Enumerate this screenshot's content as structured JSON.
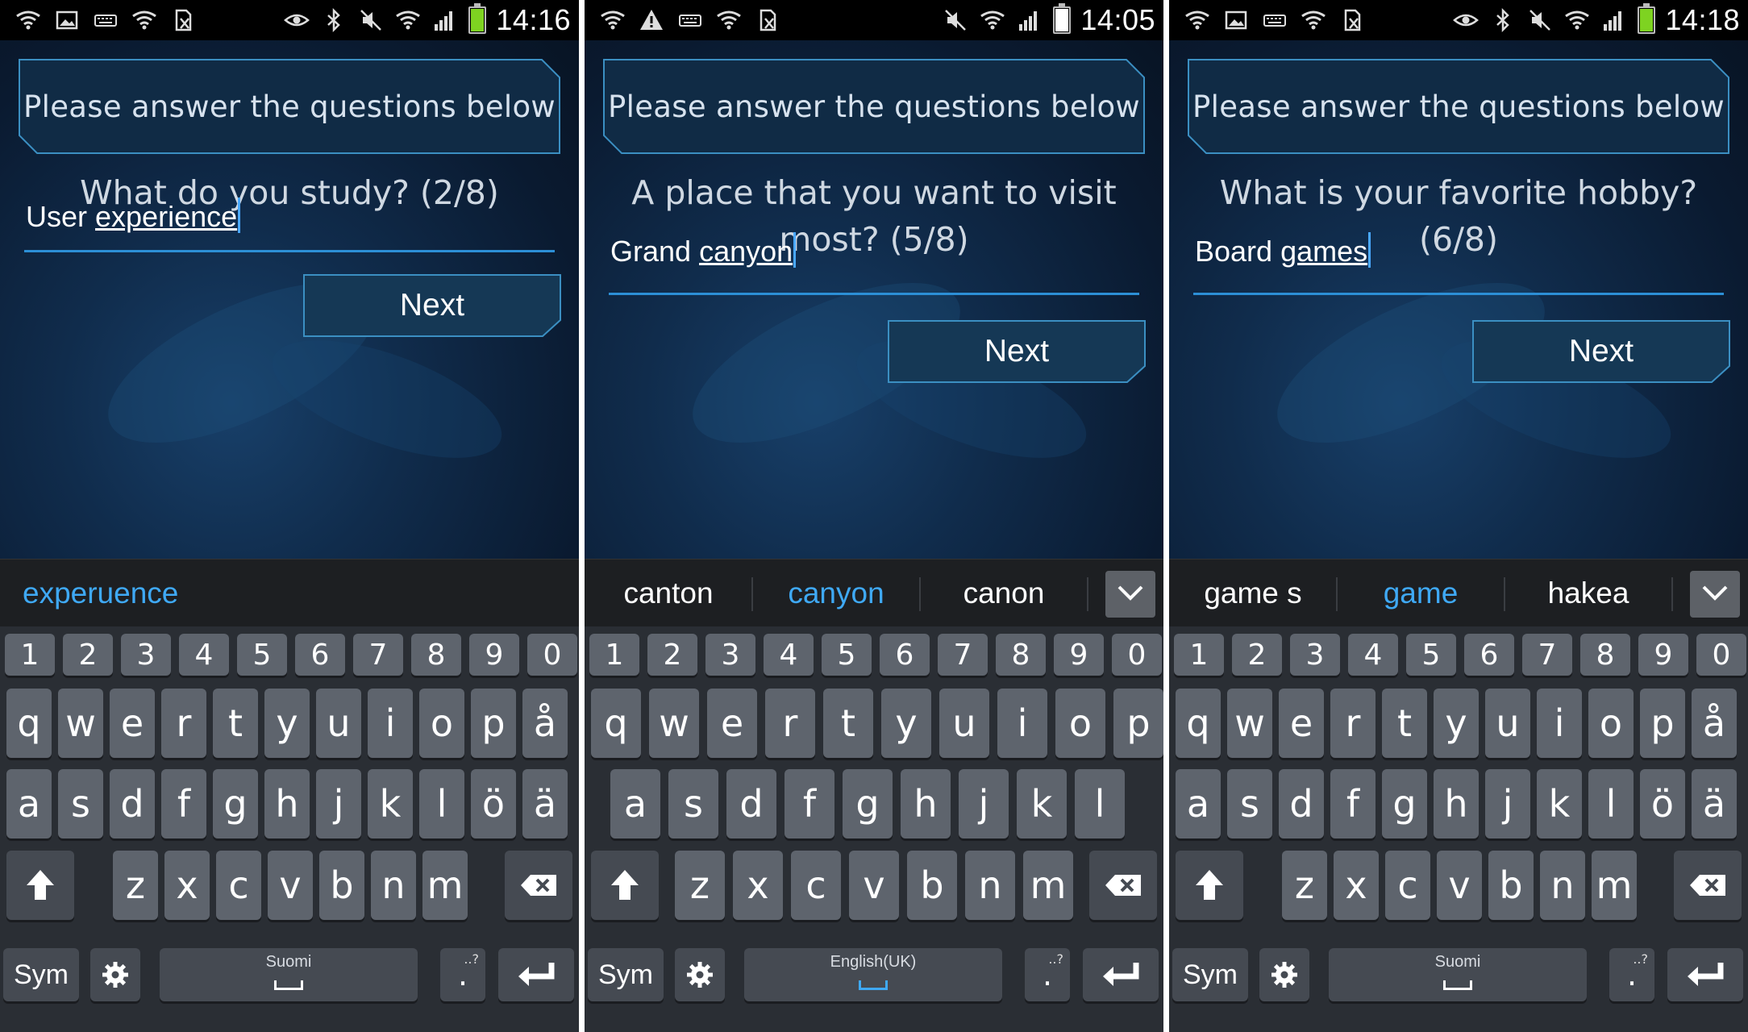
{
  "banner_text": "Please answer the questions below",
  "next_label": "Next",
  "sym_label": "Sym",
  "number_row": [
    "1",
    "2",
    "3",
    "4",
    "5",
    "6",
    "7",
    "8",
    "9",
    "0"
  ],
  "row_q_fi": [
    "q",
    "w",
    "e",
    "r",
    "t",
    "y",
    "u",
    "i",
    "o",
    "p",
    "å"
  ],
  "row_a_fi": [
    "a",
    "s",
    "d",
    "f",
    "g",
    "h",
    "j",
    "k",
    "l",
    "ö",
    "ä"
  ],
  "row_q_en": [
    "q",
    "w",
    "e",
    "r",
    "t",
    "y",
    "u",
    "i",
    "o",
    "p"
  ],
  "row_a_en": [
    "a",
    "s",
    "d",
    "f",
    "g",
    "h",
    "j",
    "k",
    "l"
  ],
  "row_z": [
    "z",
    "x",
    "c",
    "v",
    "b",
    "n",
    "m"
  ],
  "colors": {
    "accent": "#3fa9f5",
    "battery_green": "#7ed321",
    "battery_white": "#ffffff",
    "banner_stroke": "#3b8fc2"
  },
  "phones": [
    {
      "time": "14:16",
      "status_left_icons": [
        "wifi-icon",
        "image-icon",
        "keyboard-icon",
        "wifi-icon",
        "no-sim-icon"
      ],
      "status_right_icons": [
        "eye-icon",
        "bluetooth-icon",
        "mute-icon",
        "wifi-icon",
        "signal-icon",
        "battery-icon"
      ],
      "battery_color": "#7ed321",
      "question": "What do you study? (2/8)",
      "answer_plain": "User ",
      "answer_underlined": "experience",
      "suggestions": [
        "experuence"
      ],
      "highlighted": 0,
      "space_label": "Suomi",
      "layout": "fi"
    },
    {
      "time": "14:05",
      "status_left_icons": [
        "wifi-icon",
        "warning-icon",
        "keyboard-icon",
        "wifi-icon",
        "no-sim-icon"
      ],
      "status_right_icons": [
        "mute-icon",
        "wifi-icon",
        "signal-icon",
        "battery-icon"
      ],
      "battery_color": "#ffffff",
      "question": "A place that you want to visit most? (5/8)",
      "answer_plain": "Grand ",
      "answer_underlined": "canyon",
      "suggestions": [
        "canton",
        "canyon",
        "canon"
      ],
      "highlighted": 1,
      "space_label": "English(UK)",
      "layout": "en"
    },
    {
      "time": "14:18",
      "status_left_icons": [
        "wifi-icon",
        "image-icon",
        "keyboard-icon",
        "wifi-icon",
        "no-sim-icon"
      ],
      "status_right_icons": [
        "eye-icon",
        "bluetooth-icon",
        "mute-icon",
        "wifi-icon",
        "signal-icon",
        "battery-icon"
      ],
      "battery_color": "#7ed321",
      "question": "What is your favorite hobby? (6/8)",
      "answer_plain": "Board ",
      "answer_underlined": "games",
      "suggestions": [
        "game s",
        "game",
        "hakea"
      ],
      "highlighted": 1,
      "space_label": "Suomi",
      "layout": "fi"
    }
  ]
}
